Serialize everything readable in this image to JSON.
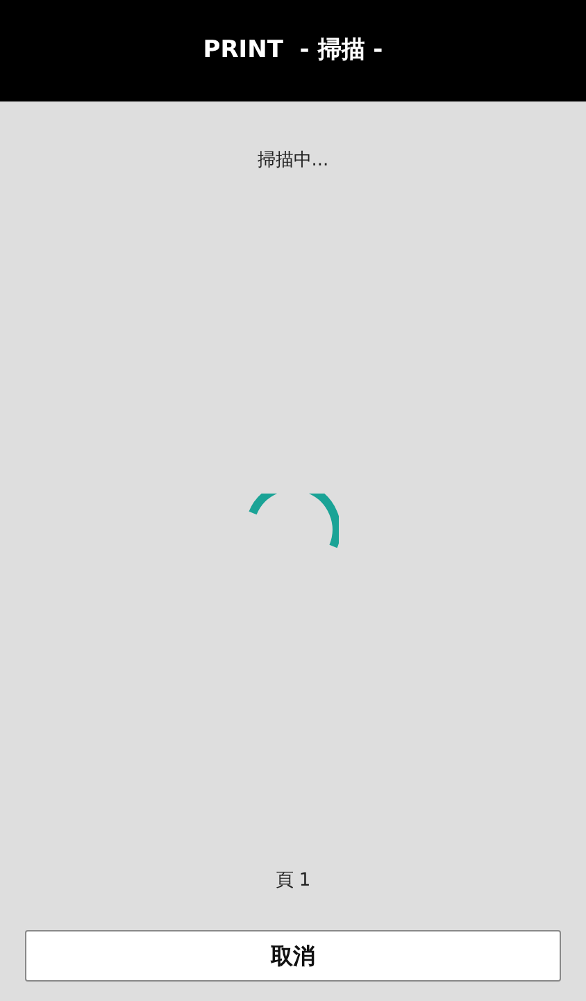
{
  "header": {
    "title": "PRINT  - 掃描 -"
  },
  "status": "掃描中...",
  "page_label": "頁 1",
  "cancel_button": "取消"
}
